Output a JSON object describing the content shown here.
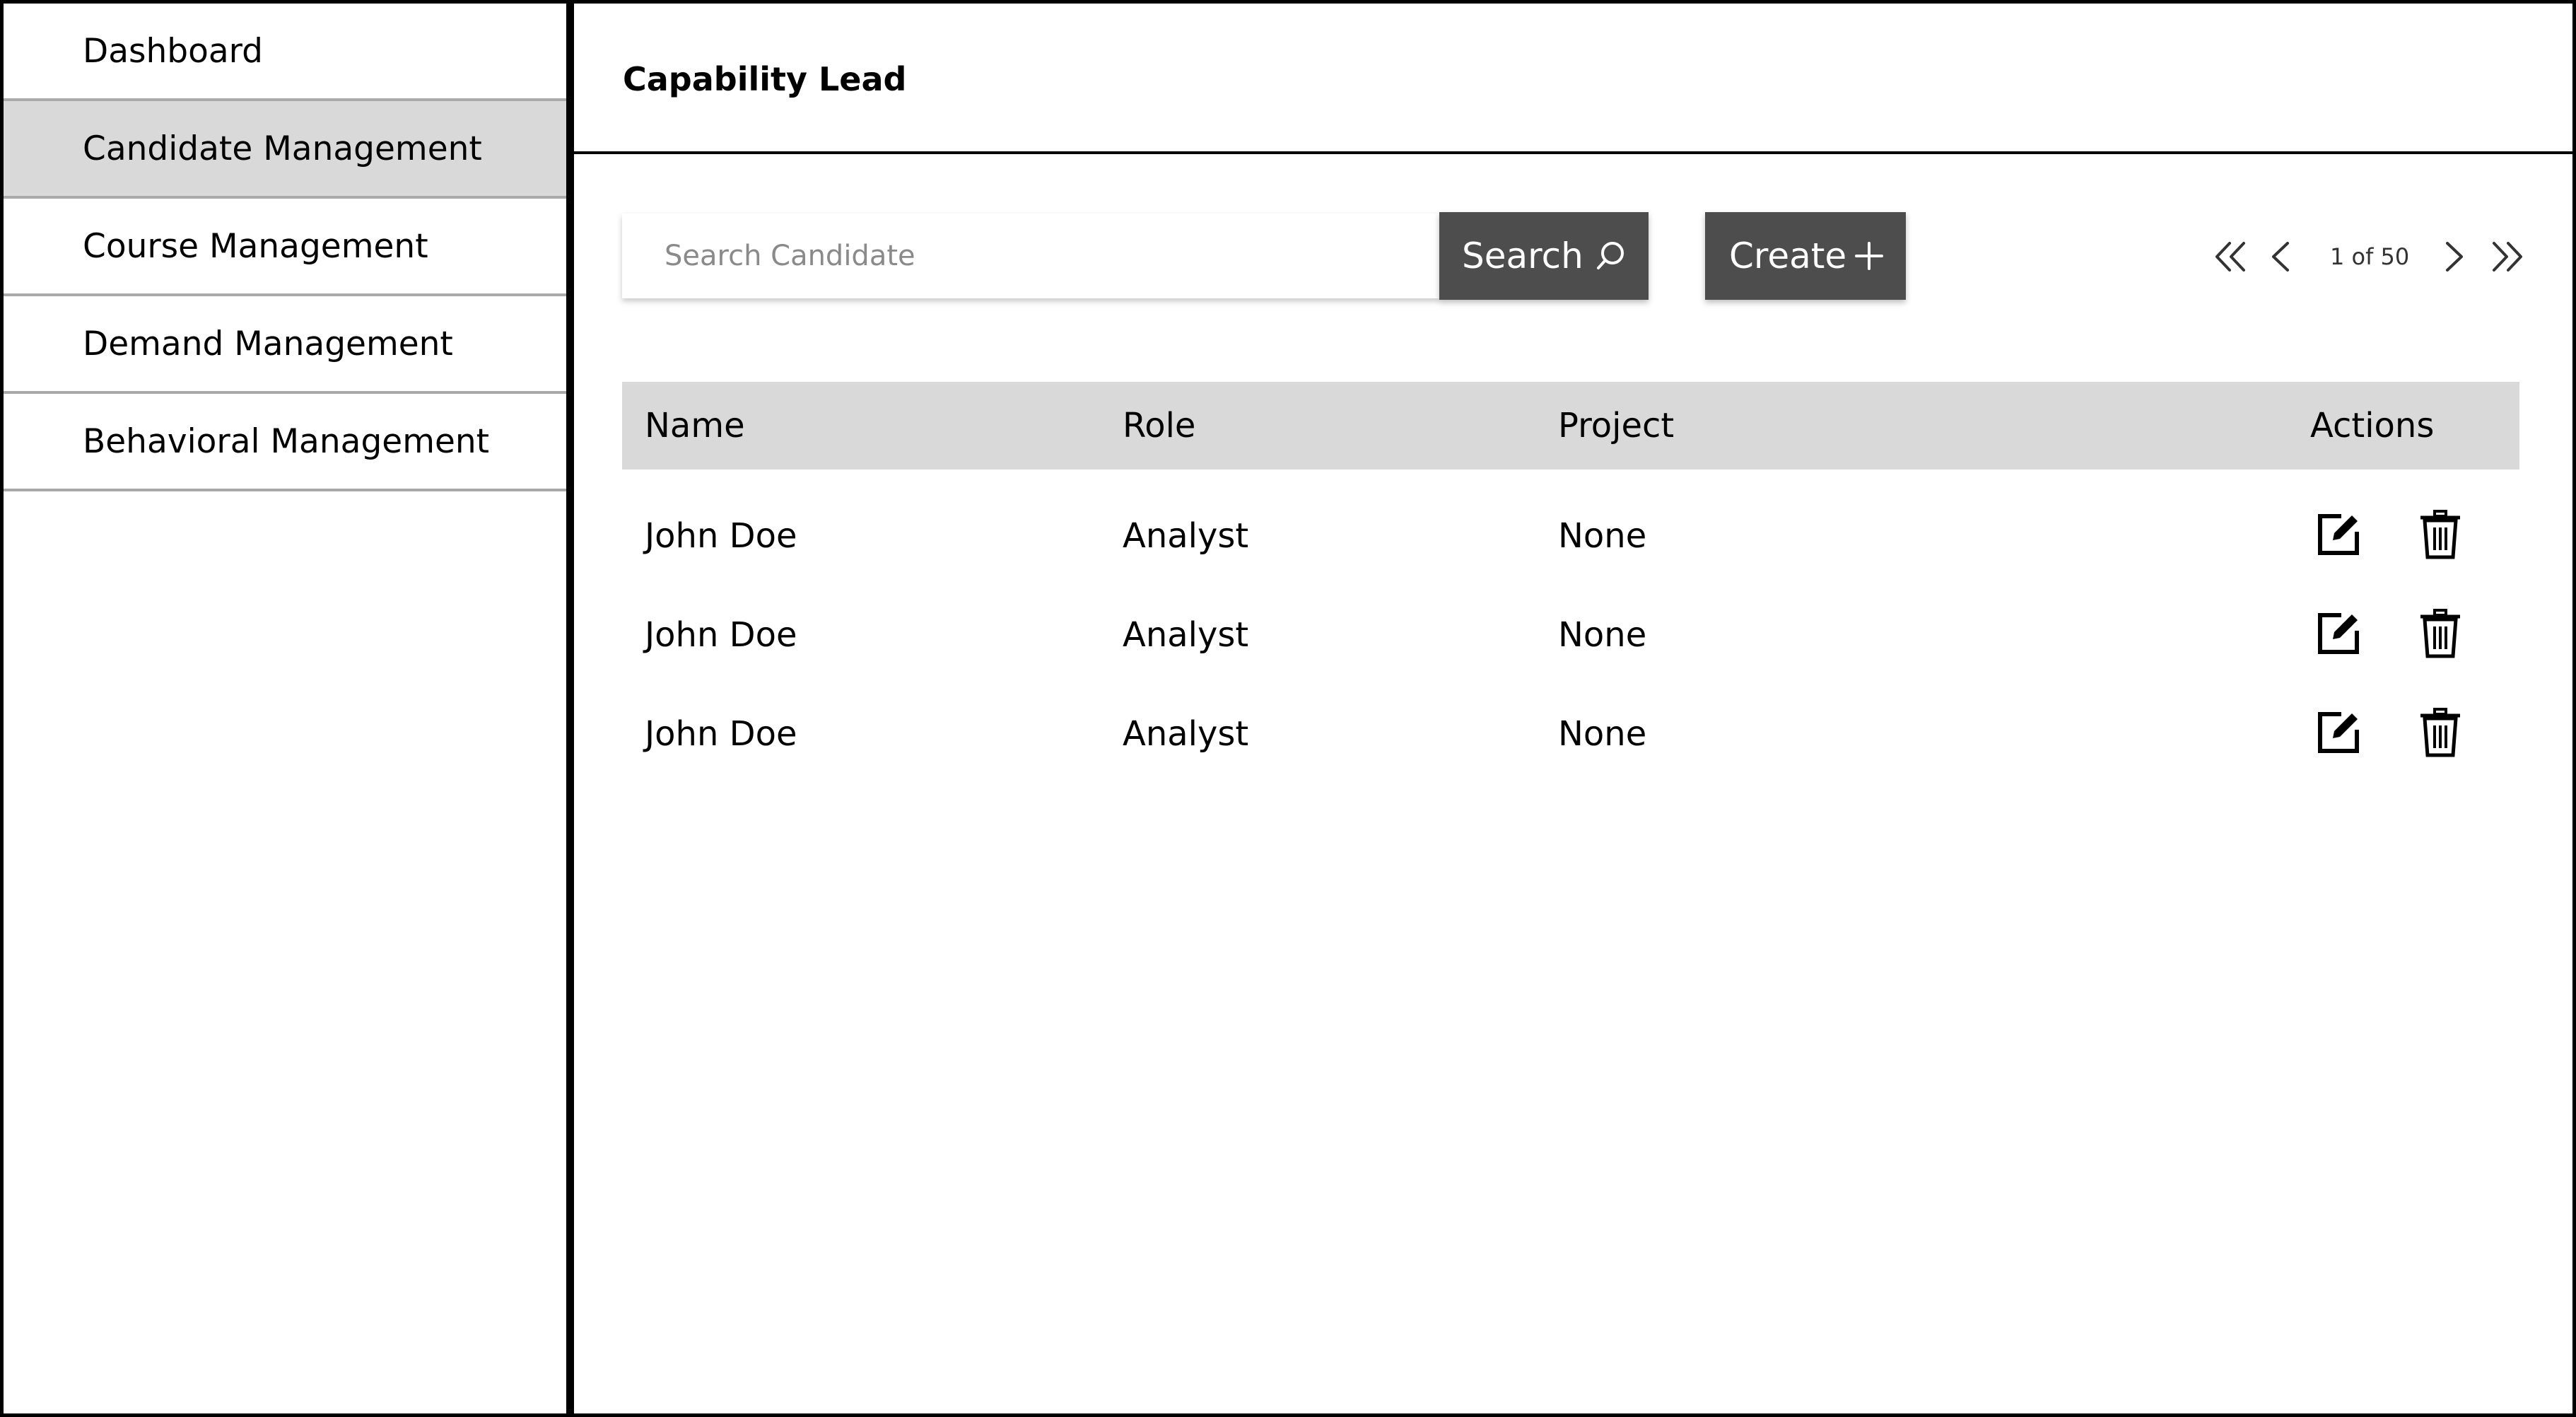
{
  "sidebar": {
    "items": [
      {
        "label": "Dashboard",
        "active": false
      },
      {
        "label": "Candidate Management",
        "active": true
      },
      {
        "label": "Course Management",
        "active": false
      },
      {
        "label": "Demand Management",
        "active": false
      },
      {
        "label": "Behavioral Management",
        "active": false
      }
    ]
  },
  "header": {
    "title": "Capability Lead"
  },
  "toolbar": {
    "search_placeholder": "Search Candidate",
    "search_label": "Search",
    "search_icon": "search-icon",
    "create_label": "Create",
    "create_icon": "plus-icon"
  },
  "pagination": {
    "text": "1 of 50",
    "icons": [
      "first-page-icon",
      "prev-page-icon",
      "next-page-icon",
      "last-page-icon"
    ]
  },
  "table": {
    "columns": [
      "Name",
      "Role",
      "Project",
      "Actions"
    ],
    "rows": [
      {
        "name": "John Doe",
        "role": "Analyst",
        "project": "None"
      },
      {
        "name": "John Doe",
        "role": "Analyst",
        "project": "None"
      },
      {
        "name": "John Doe",
        "role": "Analyst",
        "project": "None"
      }
    ],
    "action_icons": [
      "edit-icon",
      "trash-icon"
    ]
  },
  "colors": {
    "active_nav_bg": "#d9d9d9",
    "button_bg": "#4d4d4d",
    "table_header_bg": "#d9d9d9"
  }
}
